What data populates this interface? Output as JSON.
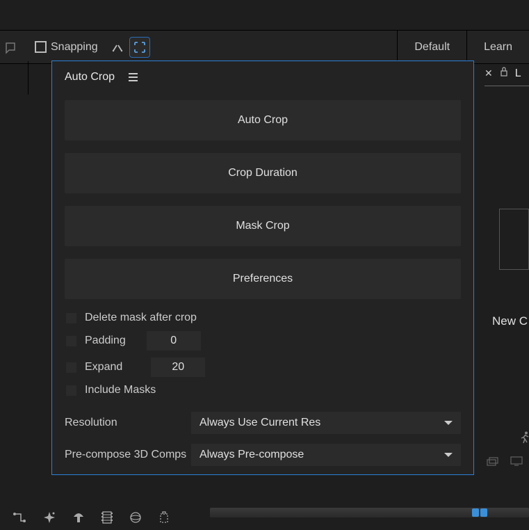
{
  "toolbar": {
    "snapping_label": "Snapping"
  },
  "workspace_tabs": [
    "Default",
    "Learn"
  ],
  "panel": {
    "title": "Auto Crop",
    "buttons": [
      "Auto Crop",
      "Crop Duration",
      "Mask Crop",
      "Preferences"
    ],
    "opt_delete_mask": "Delete mask after crop",
    "opt_padding": "Padding",
    "val_padding": "0",
    "opt_expand": "Expand",
    "val_expand": "20",
    "opt_include_masks": "Include Masks",
    "resolution_label": "Resolution",
    "resolution_value": "Always Use Current Res",
    "precompose_label": "Pre-compose 3D Comps",
    "precompose_value": "Always Pre-compose"
  },
  "right": {
    "tab_letter": "L",
    "new_text": "New C"
  }
}
